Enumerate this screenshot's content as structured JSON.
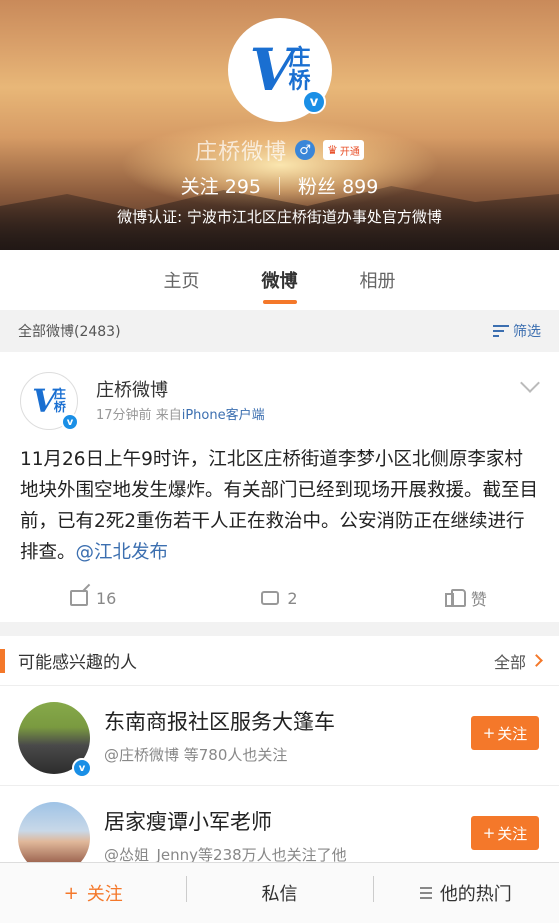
{
  "profile": {
    "logo_letter": "V",
    "logo_chars": [
      "庄",
      "桥"
    ],
    "verified_mark": "v",
    "name": "庄桥微博",
    "vip_label": "开通",
    "following_label": "关注",
    "following_count": "295",
    "followers_label": "粉丝",
    "followers_count": "899",
    "certification": "微博认证: 宁波市江北区庄桥街道办事处官方微博"
  },
  "tabs": [
    {
      "label": "主页",
      "active": false
    },
    {
      "label": "微博",
      "active": true
    },
    {
      "label": "相册",
      "active": false
    }
  ],
  "filter_bar": {
    "all_posts": "全部微博(2483)",
    "filter_label": "筛选"
  },
  "post": {
    "author": "庄桥微博",
    "time": "17分钟前",
    "source_prefix": "来自",
    "source": "iPhone客户端",
    "text": "11月26日上午9时许，江北区庄桥街道李梦小区北侧原李家村地块外围空地发生爆炸。有关部门已经到现场开展救援。截至目前，已有2死2重伤若干人正在救治中。公安消防正在继续进行排查。",
    "mention": "@江北发布",
    "reposts": "16",
    "comments": "2",
    "like_label": "赞"
  },
  "suggestions": {
    "title": "可能感兴趣的人",
    "all_label": "全部",
    "people": [
      {
        "name": "东南商报社区服务大篷车",
        "desc": "@庄桥微博 等780人也关注",
        "follow_label": "关注"
      },
      {
        "name": "居家瘦谭小军老师",
        "desc": "@怂姐_Jenny等238万人也关注了他",
        "follow_label": "关注"
      }
    ]
  },
  "bottom_bar": {
    "follow": "关注",
    "message": "私信",
    "hot": "他的热门"
  }
}
